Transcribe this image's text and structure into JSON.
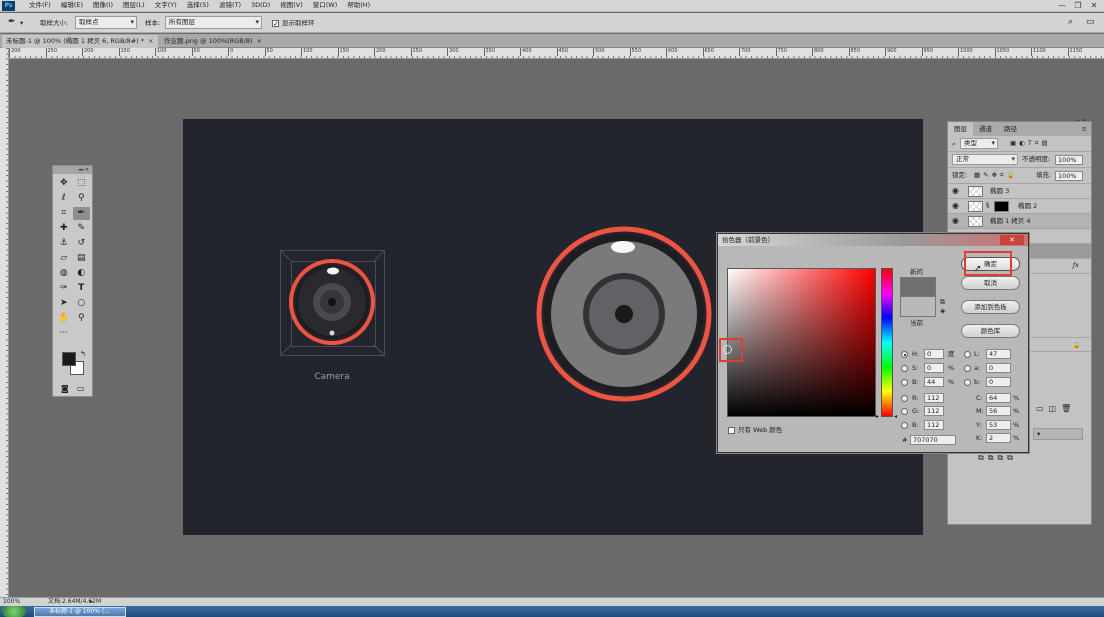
{
  "menubar": {
    "logo": "Ps",
    "items": [
      "文件(F)",
      "编辑(E)",
      "图像(I)",
      "图层(L)",
      "文字(Y)",
      "选择(S)",
      "滤镜(T)",
      "3D(D)",
      "视图(V)",
      "窗口(W)",
      "帮助(H)"
    ],
    "minimize": "—",
    "restore": "❐",
    "close": "✕"
  },
  "options": {
    "sample_size_label": "取样大小:",
    "sample_size_value": "取样点",
    "sample_label": "样本:",
    "sample_value": "所有图层",
    "show_ring_label": "显示取样环"
  },
  "tabs": [
    {
      "label": "未标题-1 @ 100% (椭圆 1 拷贝 6, RGB/8#) *",
      "close": "×"
    },
    {
      "label": "作业题.png @ 100%(RGB/8)",
      "close": "×"
    }
  ],
  "ruler_ticks": [
    "200",
    "250",
    "200",
    "150",
    "100",
    "50",
    "0",
    "50",
    "100",
    "150",
    "200",
    "250",
    "300",
    "350",
    "400",
    "450",
    "500",
    "550",
    "600",
    "650",
    "700",
    "750",
    "800",
    "850",
    "900",
    "950",
    "1000",
    "1050",
    "1100",
    "1150"
  ],
  "canvas": {
    "camera_label": "Camera",
    "accent": "#f0533f",
    "background": "#22252d"
  },
  "layers": {
    "tabs": [
      "图层",
      "通道",
      "路径"
    ],
    "kind_filter": "类型",
    "blend_mode": "正常",
    "opacity_label": "不透明度:",
    "opacity_value": "100%",
    "lock_label": "锁定:",
    "fill_label": "填充:",
    "fill_value": "100%",
    "rows": [
      "椭圆 3",
      "椭圆 2",
      "椭圆 1 拷贝 4"
    ]
  },
  "picker": {
    "title": "拾色器（前景色）",
    "ok": "确定",
    "cancel": "取消",
    "add_swatch": "添加到色板",
    "color_libraries": "颜色库",
    "new_label": "新的",
    "current_label": "当前",
    "web_only": "只有 Web 颜色",
    "new_color": "#707070",
    "current_color": "#b9b9b9",
    "fields": {
      "H": "0",
      "H_unit": "度",
      "S": "0",
      "S_unit": "%",
      "B": "44",
      "B_unit": "%",
      "R": "112",
      "G": "112",
      "B2": "112",
      "L": "47",
      "a": "0",
      "b": "0",
      "C": "64",
      "C_unit": "%",
      "M": "56",
      "M_unit": "%",
      "Y": "53",
      "Y_unit": "%",
      "K": "2",
      "K_unit": "%",
      "hex": "707070"
    }
  },
  "status": {
    "zoom": "100%",
    "doc_info": "文档:2.64M/4.62M"
  },
  "taskbar": {
    "item": "未标题-1 @ 100% (..."
  }
}
